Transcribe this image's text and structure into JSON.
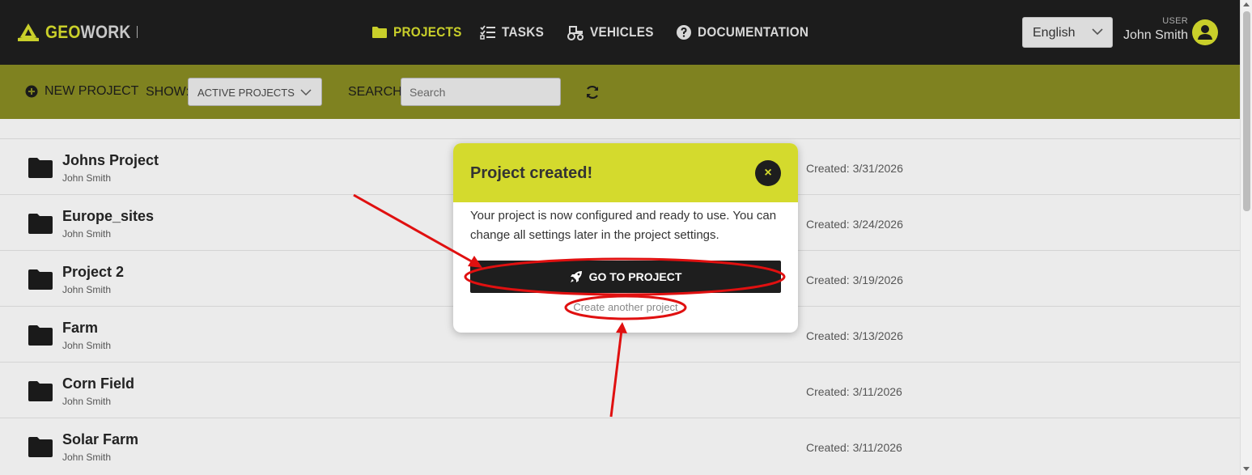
{
  "brand": {
    "part1": "GEO",
    "part2": "WORK",
    "logo_icon": "geowork-logo-icon"
  },
  "nav": {
    "items": [
      {
        "label": "PROJECTS",
        "icon": "folder-icon",
        "active": true
      },
      {
        "label": "TASKS",
        "icon": "checklist-icon",
        "active": false
      },
      {
        "label": "VEHICLES",
        "icon": "tractor-icon",
        "active": false
      },
      {
        "label": "DOCUMENTATION",
        "icon": "help-circle-icon",
        "active": false
      }
    ]
  },
  "language": {
    "selected": "English"
  },
  "user": {
    "role": "USER",
    "name": "John Smith"
  },
  "toolbar": {
    "new_project": "NEW PROJECT",
    "show_label": "SHOW:",
    "show_selected": "ACTIVE PROJECTS",
    "search_label": "SEARCH:",
    "search_placeholder": "Search"
  },
  "projects": [
    {
      "name": "Johns Project",
      "owner": "John Smith",
      "created": "Created: 3/31/2026"
    },
    {
      "name": "Europe_sites",
      "owner": "John Smith",
      "created": "Created: 3/24/2026"
    },
    {
      "name": "Project 2",
      "owner": "John Smith",
      "created": "Created: 3/19/2026"
    },
    {
      "name": "Farm",
      "owner": "John Smith",
      "created": "Created: 3/13/2026"
    },
    {
      "name": "Corn Field",
      "owner": "John Smith",
      "created": "Created: 3/11/2026"
    },
    {
      "name": "Solar Farm",
      "owner": "John Smith",
      "created": "Created: 3/11/2026"
    }
  ],
  "modal": {
    "title": "Project created!",
    "close": "×",
    "body": "Your project is now configured and ready to use. You can change all settings later in the project settings.",
    "primary_button": "GO TO PROJECT",
    "secondary_link": "Create another project"
  },
  "colors": {
    "accent": "#c9cf2a",
    "toolbar": "#7f8220",
    "modal_header": "#d4da2d",
    "annotation": "#e01010"
  }
}
